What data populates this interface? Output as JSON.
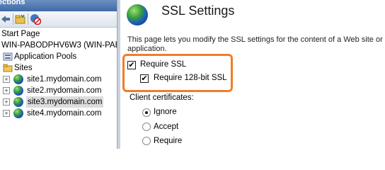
{
  "connections_panel": {
    "title": "ections",
    "toolbar": [
      {
        "icon": "back-icon"
      },
      {
        "icon": "folder-add-icon"
      },
      {
        "icon": "disconnect-icon"
      }
    ],
    "tree": {
      "start_page": "Start Page",
      "server": "WIN-PABODPHV6W3 (WIN-PABO",
      "app_pools": "Application Pools",
      "sites": "Sites",
      "site_items": [
        {
          "label": "site1.mydomain.com",
          "selected": false
        },
        {
          "label": "site2.mydomain.com",
          "selected": false
        },
        {
          "label": "site3.mydomain.com",
          "selected": true
        },
        {
          "label": "site4.mydomain.com",
          "selected": false
        }
      ]
    }
  },
  "main": {
    "title": "SSL Settings",
    "description": "This page lets you modify the SSL settings for the content of a Web site or application.",
    "require_ssl": {
      "label": "Require SSL",
      "checked": true
    },
    "require_128": {
      "label": "Require 128-bit SSL",
      "checked": true
    },
    "client_certificates": {
      "label": "Client certificates:",
      "options": [
        {
          "label": "Ignore",
          "checked": true
        },
        {
          "label": "Accept",
          "checked": false
        },
        {
          "label": "Require",
          "checked": false
        }
      ]
    },
    "highlight_color": "#f07d28"
  }
}
